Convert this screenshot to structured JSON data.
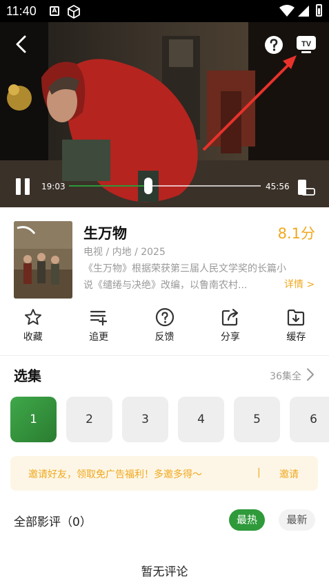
{
  "status_bar": {
    "time": "11:40",
    "notif_letter": "A"
  },
  "player": {
    "current_time": "19:03",
    "duration": "45:56",
    "progress": 0.41,
    "icons": [
      "back-arrow-icon",
      "help-icon",
      "tv-cast-icon",
      "pause-icon",
      "rotate-screen-icon"
    ]
  },
  "show": {
    "title": "生万物",
    "score": "8.1分",
    "meta": "电视 / 内地 / 2025",
    "desc_line1": "《生万物》根据荣获第三届人民文学奖的长篇小",
    "desc_line2": "说《缱绻与决绝》改编，以鲁南农村...",
    "detail_link": "详情 >"
  },
  "actions": [
    {
      "label": "收藏",
      "icon": "star-icon"
    },
    {
      "label": "追更",
      "icon": "playlist-add-icon"
    },
    {
      "label": "反馈",
      "icon": "help-circle-icon"
    },
    {
      "label": "分享",
      "icon": "share-icon"
    },
    {
      "label": "缓存",
      "icon": "download-folder-icon"
    }
  ],
  "episodes": {
    "title": "选集",
    "total": "36集全",
    "items": [
      "1",
      "2",
      "3",
      "4",
      "5",
      "6"
    ],
    "active_index": 0
  },
  "invite": {
    "text": "邀请好友，领取免广告福利！多邀多得～",
    "separator": "|",
    "button": "邀请"
  },
  "reviews": {
    "title": "全部影评（0）",
    "sort_hot": "最热",
    "sort_new": "最新",
    "empty": "暂无评论"
  },
  "colors": {
    "accent_green": "#2e9a3a",
    "accent_orange": "#f0a81e"
  }
}
